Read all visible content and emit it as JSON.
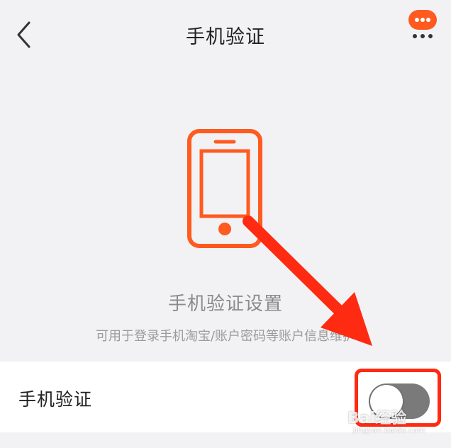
{
  "header": {
    "title": "手机验证",
    "back_icon": "chevron-left-icon",
    "more_icon": "more-chat-bubble-icon"
  },
  "hero": {
    "icon": "smartphone-icon",
    "title": "手机验证设置",
    "description": "可用于登录手机淘宝/账户密码等账户信息维护"
  },
  "setting": {
    "label": "手机验证",
    "toggle_on": false
  },
  "annotation": {
    "arrow_color": "#ff2a12",
    "highlight_color": "#ff2a12"
  },
  "watermark": {
    "brand": "Bai经验",
    "url": "jingyan.baidu.com"
  },
  "colors": {
    "accent": "#ff5a1f",
    "background": "#f2f2f4",
    "toggle_off": "#7a7a7a"
  }
}
